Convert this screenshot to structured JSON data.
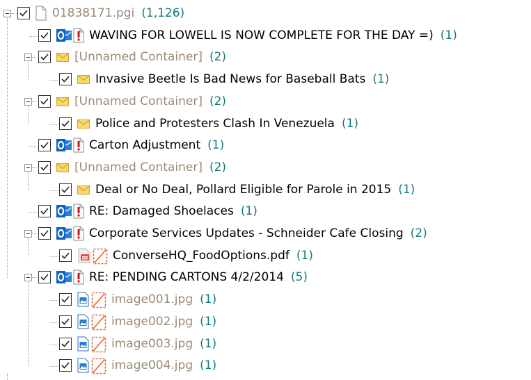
{
  "tree": [
    {
      "label": "01838171.pgi",
      "count": "(1,126)",
      "level": 0,
      "icons": [
        "page-icon"
      ],
      "style": "gray",
      "expander": true
    },
    {
      "label": "WAVING FOR LOWELL IS NOW COMPLETE FOR THE DAY =)",
      "count": "(1)",
      "level": 1,
      "icons": [
        "outlook-icon",
        "missing-page-icon"
      ],
      "style": "normal",
      "expander": false
    },
    {
      "label": "[Unnamed Container]",
      "count": "(2)",
      "level": 1,
      "icons": [
        "envelope-icon"
      ],
      "style": "gray",
      "expander": true
    },
    {
      "label": "Invasive Beetle Is Bad News for Baseball Bats",
      "count": "(1)",
      "level": 2,
      "icons": [
        "envelope-icon"
      ],
      "style": "normal",
      "expander": false
    },
    {
      "label": "[Unnamed Container]",
      "count": "(2)",
      "level": 1,
      "icons": [
        "envelope-icon"
      ],
      "style": "gray",
      "expander": true
    },
    {
      "label": "Police and Protesters Clash In Venezuela",
      "count": "(1)",
      "level": 2,
      "icons": [
        "envelope-icon"
      ],
      "style": "normal",
      "expander": false
    },
    {
      "label": "Carton Adjustment",
      "count": "(1)",
      "level": 1,
      "icons": [
        "outlook-icon",
        "missing-page-icon"
      ],
      "style": "normal",
      "expander": false
    },
    {
      "label": "[Unnamed Container]",
      "count": "(2)",
      "level": 1,
      "icons": [
        "envelope-icon"
      ],
      "style": "gray",
      "expander": true
    },
    {
      "label": "Deal or No Deal, Pollard Eligible for Parole in 2015",
      "count": "(1)",
      "level": 2,
      "icons": [
        "envelope-icon"
      ],
      "style": "normal",
      "expander": false
    },
    {
      "label": "RE: Damaged Shoelaces",
      "count": "(1)",
      "level": 1,
      "icons": [
        "outlook-icon",
        "missing-page-icon"
      ],
      "style": "normal",
      "expander": false
    },
    {
      "label": "Corporate Services Updates - Schneider Cafe Closing",
      "count": "(2)",
      "level": 1,
      "icons": [
        "outlook-icon",
        "missing-page-icon"
      ],
      "style": "normal",
      "expander": true
    },
    {
      "label": "ConverseHQ_FoodOptions.pdf",
      "count": "(1)",
      "level": 2,
      "icons": [
        "pdf-icon",
        "broken-image-icon"
      ],
      "style": "normal",
      "expander": false
    },
    {
      "label": "RE: PENDING CARTONS 4/2/2014",
      "count": "(5)",
      "level": 1,
      "icons": [
        "outlook-icon",
        "missing-page-icon"
      ],
      "style": "normal",
      "expander": true
    },
    {
      "label": "image001.jpg",
      "count": "(1)",
      "level": 2,
      "icons": [
        "image-file-icon",
        "broken-image-icon"
      ],
      "style": "gray",
      "expander": false
    },
    {
      "label": "image002.jpg",
      "count": "(1)",
      "level": 2,
      "icons": [
        "image-file-icon",
        "broken-image-icon"
      ],
      "style": "gray",
      "expander": false
    },
    {
      "label": "image003.jpg",
      "count": "(1)",
      "level": 2,
      "icons": [
        "image-file-icon",
        "broken-image-icon"
      ],
      "style": "gray",
      "expander": false
    },
    {
      "label": "image004.jpg",
      "count": "(1)",
      "level": 2,
      "icons": [
        "image-file-icon",
        "broken-image-icon"
      ],
      "style": "gray",
      "expander": false
    }
  ],
  "colors": {
    "count": "#147a7a",
    "gray_label": "#9b8a78",
    "outlook_blue": "#0a64c8",
    "alert_red": "#d0101a",
    "envelope": "#f2c84b",
    "broken_orange": "#e8622a"
  }
}
